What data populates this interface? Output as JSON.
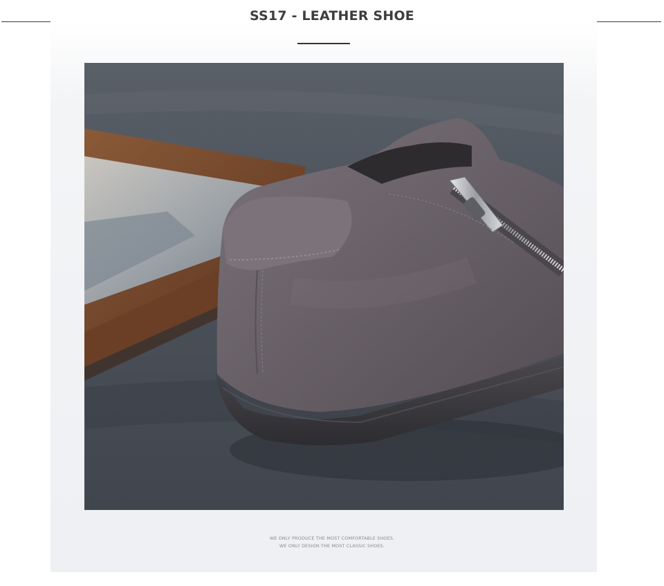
{
  "header": {
    "title": "SS17 - LEATHER SHOE"
  },
  "photo": {
    "subject": "grey suede slip-on shoe with side zipper"
  },
  "footer": {
    "line1": "WE ONLY PRODUCE THE MOST COMFORTABLE SHOES.",
    "line2": "WE ONLY DESIGN THE MOST CLASSIC SHOES."
  },
  "colors": {
    "title": "#3d3d3d",
    "rule": "#333333",
    "suede": "#6a6369",
    "sole": "#3b3a3d",
    "wood": "#7a4a2c",
    "floor": "#4a5059"
  }
}
